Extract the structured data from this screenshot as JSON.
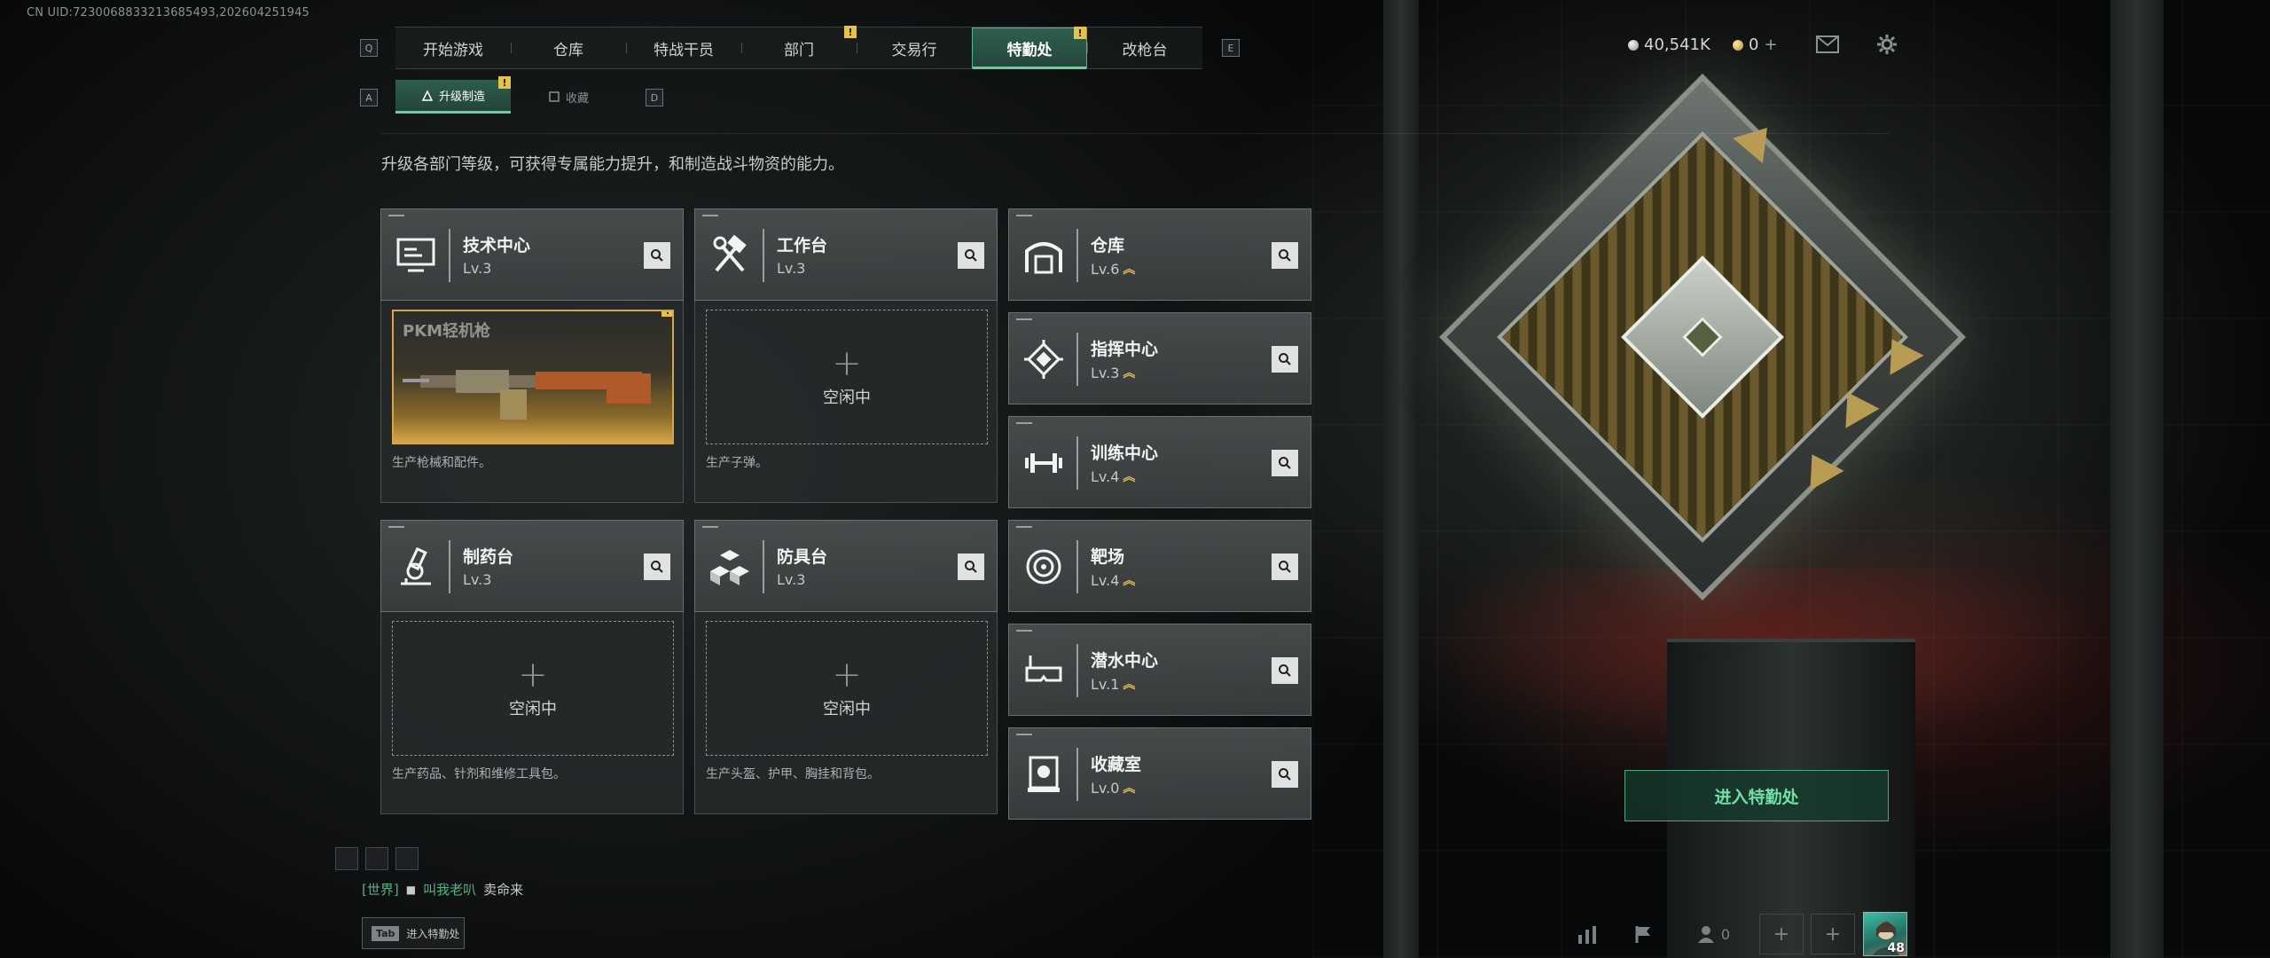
{
  "uid": "CN UID:7230068833213685493,202604251945",
  "nav": {
    "key_left": "Q",
    "key_right": "E",
    "tabs": [
      {
        "label": "开始游戏",
        "badge": ""
      },
      {
        "label": "仓库",
        "badge": ""
      },
      {
        "label": "特战干员",
        "badge": ""
      },
      {
        "label": "部门",
        "badge": "!"
      },
      {
        "label": "交易行",
        "badge": ""
      },
      {
        "label": "特勤处",
        "badge": "!",
        "active": true
      },
      {
        "label": "改枪台",
        "badge": ""
      }
    ]
  },
  "subnav": {
    "key_left": "A",
    "key_right": "D",
    "tabs": [
      {
        "label": "升级制造",
        "badge": "!",
        "active": true
      },
      {
        "label": "收藏",
        "badge": ""
      }
    ]
  },
  "description": "升级各部门等级，可获得专属能力提升，和制造战斗物资的能力。",
  "currency": {
    "silver": "40,541K",
    "gold": "0"
  },
  "production_cards": [
    {
      "name": "技术中心",
      "level": "Lv.3",
      "icon": "monitor-icon",
      "slot_state": "producing",
      "slot_item": "PKM轻机枪",
      "slot_badge": "!",
      "note": "生产枪械和配件。"
    },
    {
      "name": "工作台",
      "level": "Lv.3",
      "icon": "hammer-wrench-icon",
      "slot_state": "idle",
      "slot_text": "空闲中",
      "note": "生产子弹。"
    },
    {
      "name": "制药台",
      "level": "Lv.3",
      "icon": "microscope-icon",
      "slot_state": "idle",
      "slot_text": "空闲中",
      "note": "生产药品、针剂和维修工具包。"
    },
    {
      "name": "防具台",
      "level": "Lv.3",
      "icon": "cubes-icon",
      "slot_state": "idle",
      "slot_text": "空闲中",
      "note": "生产头盔、护甲、胸挂和背包。"
    }
  ],
  "facility_cards": [
    {
      "name": "仓库",
      "level": "Lv.6",
      "icon": "warehouse-icon",
      "upgradable": true
    },
    {
      "name": "指挥中心",
      "level": "Lv.3",
      "icon": "chip-icon",
      "upgradable": true
    },
    {
      "name": "训练中心",
      "level": "Lv.4",
      "icon": "dumbbell-icon",
      "upgradable": true
    },
    {
      "name": "靶场",
      "level": "Lv.4",
      "icon": "target-icon",
      "upgradable": true
    },
    {
      "name": "潜水中心",
      "level": "Lv.1",
      "icon": "diving-mask-icon",
      "upgradable": true
    },
    {
      "name": "收藏室",
      "level": "Lv.0",
      "icon": "trophy-case-icon",
      "upgradable": true
    }
  ],
  "enter_button": "进入特勤处",
  "chat": {
    "channel": "[世界]",
    "sender": "叫我老叭",
    "message": "卖命来"
  },
  "tab_hint": {
    "key": "Tab",
    "label": "进入特勤处"
  },
  "friends_count": "0",
  "player_level": "48",
  "colors": {
    "accent_green": "#5dd59a",
    "badge_yellow": "#e6c443",
    "upgrade_gold": "#e2b84a",
    "producing_border": "#d8a544"
  }
}
